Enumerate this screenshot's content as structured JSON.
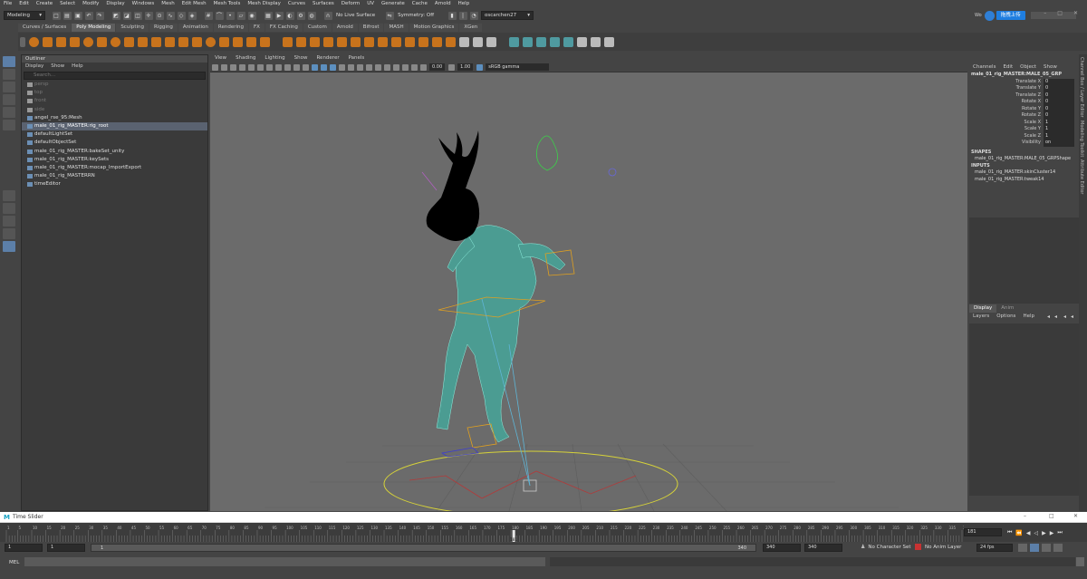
{
  "menus": [
    "File",
    "Edit",
    "Create",
    "Select",
    "Modify",
    "Display",
    "Windows",
    "Mesh",
    "Edit Mesh",
    "Mesh Tools",
    "Mesh Display",
    "Curves",
    "Surfaces",
    "Deform",
    "UV",
    "Generate",
    "Cache",
    "Arnold",
    "Help"
  ],
  "status": {
    "mode": "Modeling",
    "live_surface": "No Live Surface",
    "symmetry": "Symmetry: Off",
    "user": "oscarchen27",
    "upload_label": "拖拽上传"
  },
  "shelf_tabs": [
    "Curves / Surfaces",
    "Poly Modeling",
    "Sculpting",
    "Rigging",
    "Animation",
    "Rendering",
    "FX",
    "FX Caching",
    "Custom",
    "Arnold",
    "Bifrost",
    "MASH",
    "Motion Graphics",
    "XGen"
  ],
  "outliner": {
    "title": "Outliner",
    "menu": [
      "Display",
      "Show",
      "Help"
    ],
    "search_placeholder": "Search...",
    "items": [
      {
        "label": "persp",
        "dim": true,
        "icon": "camera-icon"
      },
      {
        "label": "top",
        "dim": true,
        "icon": "camera-icon"
      },
      {
        "label": "front",
        "dim": true,
        "icon": "camera-icon"
      },
      {
        "label": "side",
        "dim": true,
        "icon": "camera-icon"
      },
      {
        "label": "angel_rse_95:Mesh",
        "dim": false,
        "icon": "mesh-icon"
      },
      {
        "label": "male_01_rig_MASTER:rig_root",
        "dim": false,
        "selected": true,
        "icon": "joint-icon"
      },
      {
        "label": "defaultLightSet",
        "dim": false,
        "icon": "set-icon"
      },
      {
        "label": "defaultObjectSet",
        "dim": false,
        "icon": "set-icon"
      },
      {
        "label": "male_01_rig_MASTER:bakeSet_unity",
        "dim": false,
        "icon": "set-icon"
      },
      {
        "label": "male_01_rig_MASTER:keySets",
        "dim": false,
        "icon": "set-icon"
      },
      {
        "label": "male_01_rig_MASTER:mocap_ImportExport",
        "dim": false,
        "icon": "set-icon"
      },
      {
        "label": "male_01_rig_MASTERRN",
        "dim": false,
        "icon": "reference-icon"
      },
      {
        "label": "timeEditor",
        "dim": false,
        "icon": "editor-icon"
      }
    ]
  },
  "viewport": {
    "menu": [
      "View",
      "Shading",
      "Lighting",
      "Show",
      "Renderer",
      "Panels"
    ],
    "exposure": "0.00",
    "gamma": "1.00",
    "colorspace": "sRGB gamma"
  },
  "channelbox": {
    "menu": [
      "Channels",
      "Edit",
      "Object",
      "Show"
    ],
    "object": "male_01_rig_MASTER:MALE_05_GRP",
    "attrs": [
      {
        "name": "Translate X",
        "value": "0"
      },
      {
        "name": "Translate Y",
        "value": "0"
      },
      {
        "name": "Translate Z",
        "value": "0"
      },
      {
        "name": "Rotate X",
        "value": "0"
      },
      {
        "name": "Rotate Y",
        "value": "0"
      },
      {
        "name": "Rotate Z",
        "value": "0"
      },
      {
        "name": "Scale X",
        "value": "1"
      },
      {
        "name": "Scale Y",
        "value": "1"
      },
      {
        "name": "Scale Z",
        "value": "1"
      },
      {
        "name": "Visibility",
        "value": "on"
      }
    ],
    "shapes_label": "SHAPES",
    "shape": "male_01_rig_MASTER:MALE_05_GRPShape",
    "inputs_label": "INPUTS",
    "inputs": [
      "male_01_rig_MASTER:skinCluster14",
      "male_01_rig_MASTER:tweak14"
    ],
    "layer_tabs": [
      "Display",
      "Anim"
    ],
    "layer_menu": [
      "Layers",
      "Options",
      "Help"
    ],
    "side_tabs": [
      "Channel Box / Layer Editor",
      "Modeling Toolkit",
      "Attribute Editor"
    ]
  },
  "timeslider": {
    "title": "Time Slider",
    "current_frame": "181",
    "current_frame_field": "181",
    "ticks": [
      "1",
      "5",
      "10",
      "15",
      "20",
      "25",
      "30",
      "35",
      "40",
      "45",
      "50",
      "55",
      "60",
      "65",
      "70",
      "75",
      "80",
      "85",
      "90",
      "95",
      "100",
      "105",
      "110",
      "115",
      "120",
      "125",
      "130",
      "135",
      "140",
      "145",
      "150",
      "155",
      "160",
      "165",
      "170",
      "175",
      "180",
      "185",
      "190",
      "195",
      "200",
      "205",
      "210",
      "215",
      "220",
      "225",
      "230",
      "235",
      "240",
      "245",
      "250",
      "255",
      "260",
      "265",
      "270",
      "275",
      "280",
      "285",
      "290",
      "295",
      "300",
      "305",
      "310",
      "315",
      "320",
      "325",
      "330",
      "335",
      "340"
    ]
  },
  "range": {
    "start": "1",
    "playback_start": "1",
    "slider_start": "1",
    "slider_end": "340",
    "playback_end": "340",
    "end": "340",
    "character_set": "No Character Set",
    "anim_layer": "No Anim Layer",
    "fps": "24 fps"
  },
  "mel": {
    "label": "MEL"
  }
}
